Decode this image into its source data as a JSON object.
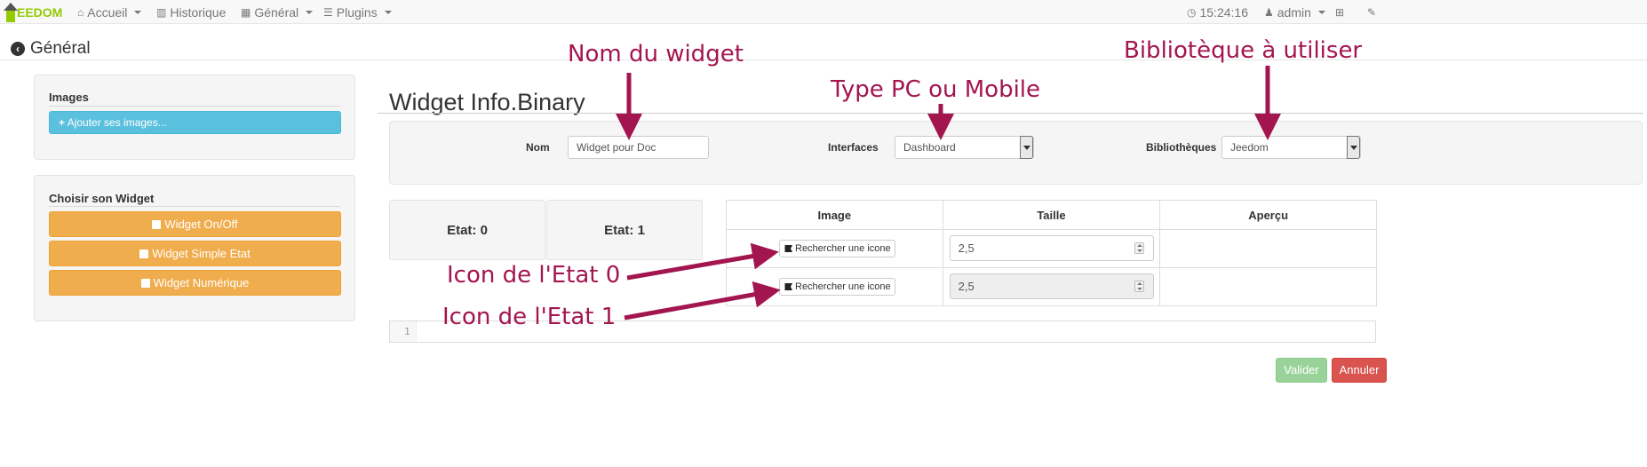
{
  "navbar": {
    "logo_text": "EEDOM",
    "items": [
      {
        "icon": "home-icon",
        "label": "Accueil",
        "dropdown": true
      },
      {
        "icon": "bar-chart-icon",
        "label": "Historique",
        "dropdown": false
      },
      {
        "icon": "grid-icon",
        "label": "Général",
        "dropdown": true
      },
      {
        "icon": "list-icon",
        "label": "Plugins",
        "dropdown": true
      }
    ],
    "clock": "15:24:16",
    "user": "admin"
  },
  "page": {
    "back_label": "Général"
  },
  "sidebar": {
    "images_legend": "Images",
    "add_images_label": "Ajouter ses images...",
    "choose_legend": "Choisir son Widget",
    "widget_buttons": [
      "Widget On/Off",
      "Widget Simple Etat",
      "Widget Numérique"
    ]
  },
  "widget": {
    "title": "Widget Info.Binary",
    "name_label": "Nom",
    "name_value": "Widget pour Doc",
    "interfaces_label": "Interfaces",
    "interfaces_value": "Dashboard",
    "libraries_label": "Bibliothèques",
    "libraries_value": "Jeedom",
    "states": [
      "Etat: 0",
      "Etat: 1"
    ]
  },
  "table": {
    "headers": [
      "Image",
      "Taille",
      "Aperçu"
    ],
    "rows": [
      {
        "image_button": "Rechercher une icone",
        "size": "2,5",
        "disabled": false
      },
      {
        "image_button": "Rechercher une icone",
        "size": "2,5",
        "disabled": true
      }
    ]
  },
  "code": {
    "line_number": "1"
  },
  "actions": {
    "validate": "Valider",
    "cancel": "Annuler"
  },
  "annotations": {
    "name": "Nom du widget",
    "type": "Type PC ou Mobile",
    "library": "Bibliotèque à utiliser",
    "icon0": "Icon de l'Etat 0",
    "icon1": "Icon de l'Etat 1",
    "color": "#a3154f"
  }
}
